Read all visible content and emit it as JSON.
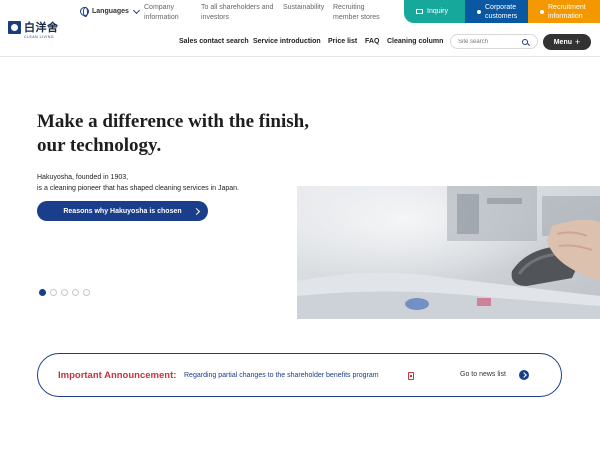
{
  "header": {
    "logo": {
      "text": "白洋舍",
      "subtext": "CLEAN LIVING",
      "icon": "hakuyosha-logo-icon"
    },
    "languages": {
      "label": "Languages",
      "icon": "globe-icon"
    },
    "top_links": [
      {
        "line1": "Company",
        "line2": "information"
      },
      {
        "line1": "To all shareholders and",
        "line2": "investors"
      },
      {
        "line1": "Sustainability",
        "line2": ""
      },
      {
        "line1": "Recruiting",
        "line2": "member stores"
      }
    ],
    "top_buttons": {
      "inquiry": {
        "label": "Inquiry",
        "color": "#17a89c",
        "icon": "mail-icon"
      },
      "corporate": {
        "line1": "Corporate",
        "line2": "customers",
        "color": "#0a57a4"
      },
      "recruit": {
        "line1": "Recruitment",
        "line2": "information",
        "color": "#f39800"
      }
    },
    "main_nav": [
      "Sales contact search",
      "Service introduction",
      "Price list",
      "FAQ",
      "Cleaning column"
    ],
    "search": {
      "placeholder": "Site search",
      "icon": "search-icon"
    },
    "menu": {
      "label": "Menu",
      "icon": "plus-icon"
    }
  },
  "hero": {
    "title_line1": "Make a difference with the finish,",
    "title_line2": "our technology.",
    "text_line1": "Hakuyosha, founded in 1903,",
    "text_line2": "is a cleaning pioneer that has shaped cleaning services in Japan.",
    "cta": "Reasons why Hakuyosha is chosen",
    "carousel": {
      "total": 5,
      "active": 1
    },
    "accent_color": "#1a3d8c"
  },
  "announcement": {
    "label": "Important Announcement:",
    "text": "Regarding partial changes to the shareholder benefits program",
    "link": "Go to news list",
    "label_color": "#c8313f"
  }
}
